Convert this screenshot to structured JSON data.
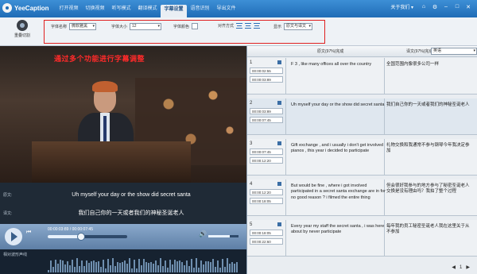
{
  "app": {
    "name": "YeeCaption"
  },
  "menu": [
    {
      "label": "打开视频"
    },
    {
      "label": "切换视频"
    },
    {
      "label": "听写模式"
    },
    {
      "label": "翻译模式"
    },
    {
      "label": "字幕设置",
      "active": true
    },
    {
      "label": "语音识别"
    },
    {
      "label": "导出文件"
    }
  ],
  "window": {
    "help": "关于我们 ▾",
    "icons": [
      "home-icon",
      "settings-icon",
      "minimize-icon",
      "maximize-icon",
      "close-icon"
    ]
  },
  "toolbar": {
    "split_label": "重叠切割",
    "font_name_label": "字体名称",
    "font_name_value": "微软雅黑",
    "font_size_label": "字体大小",
    "font_size_value": "12",
    "font_color_label": "字体颜色",
    "align_label": "对齐方式",
    "display_label": "显示",
    "display_value": "原文与译文"
  },
  "video": {
    "overlay_title": "通过多个功能进行字幕调整",
    "original_label": "原文:",
    "original_text": "Uh myself your day or the show did secret santa",
    "translation_label": "译文:",
    "translation_text": "我们自己你的一天或者我们的神秘圣诞老人"
  },
  "controls": {
    "time": "00:00:03:89 / 00:00:07:45",
    "progress": 0.42,
    "volume": 0.7
  },
  "waveform": {
    "label": "相对波形声线"
  },
  "right_panel": {
    "header_original": "原文(97%)完成",
    "header_translation": "译文(97%)完成",
    "language_value": "英语"
  },
  "entries": [
    {
      "num": "1",
      "start": "00:00:02:55",
      "end": "00:00:03:89",
      "en": "F 3 , like many offices all over the country",
      "cn": "全国范围内像很多公司一样"
    },
    {
      "num": "2",
      "start": "00:00:03:89",
      "end": "00:00:07:45",
      "en": "Uh myself your day or the show did secret santa",
      "cn": "我们自己你的一天或者我们的神秘圣诞老人"
    },
    {
      "num": "3",
      "start": "00:00:07:45",
      "end": "00:00:12:20",
      "en": "Gift exchange , and i usually i don't get involved pianos , this year i decided to participate",
      "cn": "礼物交换和我通常不参与钢琴今年我决定参加"
    },
    {
      "num": "4",
      "start": "00:00:12:20",
      "end": "00:00:18:05",
      "en": "But would be fine , where i got involved participated in a secret santa exchange are in for no good reason ? i filmed the entire thing",
      "cn": "但会很好我参与的地方参与了秘密圣诞老人交换是没有理由吗？我拍了整个过程"
    },
    {
      "num": "5",
      "start": "00:00:18:05",
      "end": "00:00:22:60",
      "en": "Every year my staff the secret santa , i was here about by never participate",
      "cn": "每年我的员工秘密圣诞老人我在这里关于从不参加"
    }
  ],
  "pager": {
    "prev": "◀",
    "next": "▶",
    "page": "1"
  }
}
